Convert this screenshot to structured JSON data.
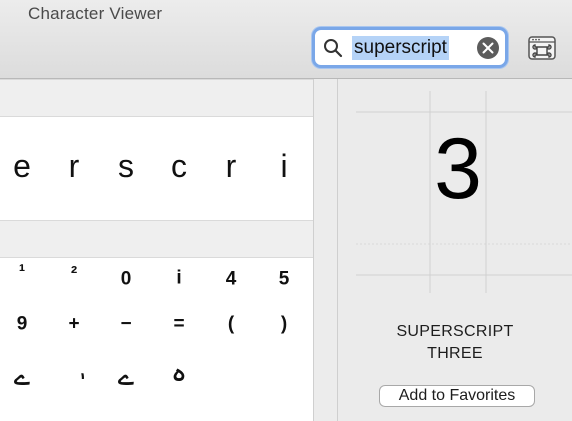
{
  "window": {
    "title": "Character Viewer"
  },
  "search": {
    "query": "superscript"
  },
  "icons": {
    "search": "magnifying-glass-icon",
    "clear": "clear-circle-x-icon",
    "layout": "command-keyboard-icon"
  },
  "results": {
    "word_row": [
      "e",
      "r",
      "s",
      "c",
      "r",
      "i"
    ],
    "grid_row_1": [
      "¹",
      "²",
      "0",
      "i",
      "4",
      "5"
    ],
    "grid_row_2": [
      "9",
      "+",
      "−",
      "=",
      "(",
      ")"
    ],
    "grid_row_3": [
      "ے",
      "ٖ",
      "ے",
      "ہ"
    ]
  },
  "detail": {
    "glyph": "3",
    "name_line1": "SUPERSCRIPT",
    "name_line2": "THREE",
    "favorites_label": "Add to Favorites"
  },
  "colors": {
    "search_focus_ring": "#7aa7e8",
    "selection_highlight": "#b5d3f7"
  }
}
